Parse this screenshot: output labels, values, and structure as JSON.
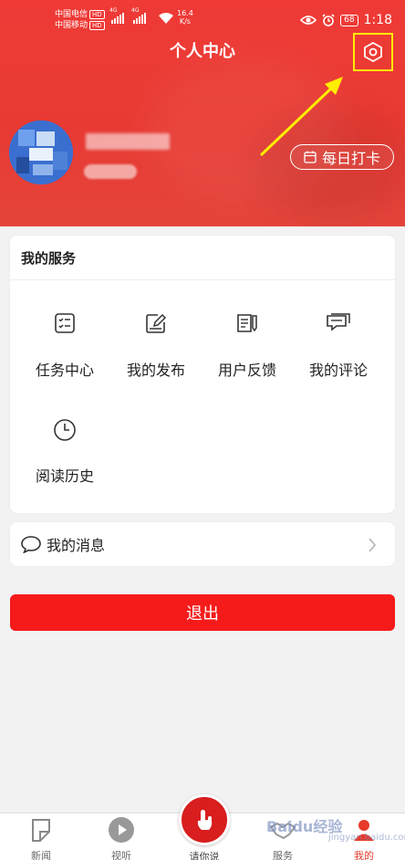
{
  "status_bar": {
    "carrier1": "中国电信",
    "carrier2": "中国移动",
    "hd": "HD",
    "net1": "4G",
    "net2": "4G",
    "speed_value": "16.4",
    "speed_unit": "K/s",
    "battery": "68",
    "time": "1:18"
  },
  "header": {
    "title": "个人中心",
    "username": " ",
    "level": " ",
    "checkin_label": "每日打卡",
    "icons": {
      "settings": "settings-hexagon-icon",
      "checkin": "calendar-icon"
    }
  },
  "services": {
    "title": "我的服务",
    "items": [
      {
        "label": "任务中心",
        "icon": "task-checklist-icon"
      },
      {
        "label": "我的发布",
        "icon": "edit-icon"
      },
      {
        "label": "用户反馈",
        "icon": "feedback-icon"
      },
      {
        "label": "我的评论",
        "icon": "comment-icon"
      },
      {
        "label": "阅读历史",
        "icon": "clock-icon"
      }
    ]
  },
  "messages": {
    "label": "我的消息",
    "icon": "chat-bubble-icon"
  },
  "logout_label": "退出",
  "bottom_nav": {
    "tabs": [
      {
        "label": "新闻",
        "icon": "news-icon"
      },
      {
        "label": "视听",
        "icon": "play-icon"
      },
      {
        "label": "请你说",
        "icon": "touch-icon"
      },
      {
        "label": "服务",
        "icon": "handshake-icon"
      },
      {
        "label": "我的",
        "icon": "user-icon"
      }
    ]
  },
  "watermark": {
    "brand": "Baidu经验",
    "url": "jingyan.baidu.com"
  },
  "colors": {
    "accent": "#f51b1b",
    "header": "#e83a33",
    "highlight": "#ffee00"
  }
}
